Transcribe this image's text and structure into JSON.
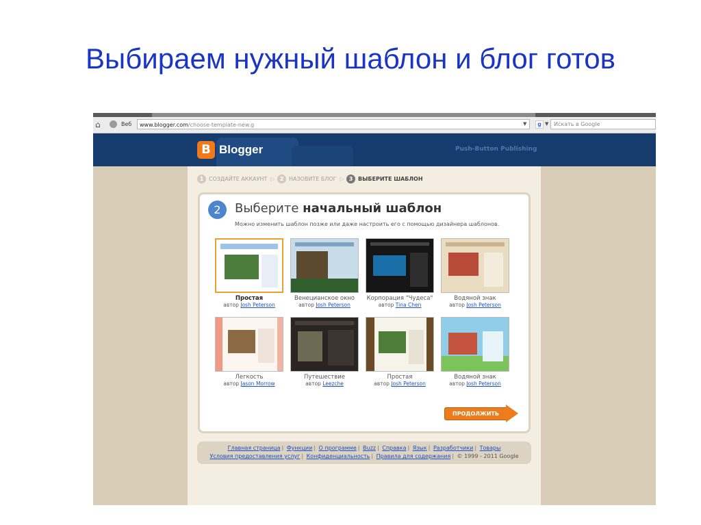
{
  "slide": {
    "title": "Выбираем нужный шаблон и блог готов"
  },
  "browser": {
    "home_icon": "home-icon",
    "web_label": "Веб",
    "url_domain": "www.blogger.com",
    "url_path": "/choose-template-new.g",
    "search_placeholder": "Искать в Google"
  },
  "blogger": {
    "logo_letter": "B",
    "name": "Blogger",
    "slogan": "Push-Button Publishing"
  },
  "steps": [
    {
      "num": "1",
      "label": "СОЗДАЙТЕ АККАУНТ"
    },
    {
      "num": "2",
      "label": "НАЗОВИТЕ БЛОГ"
    },
    {
      "num": "3",
      "label": "ВЫБЕРИТЕ ШАБЛОН"
    }
  ],
  "panel": {
    "step_number": "2",
    "title_plain": "Выберите ",
    "title_bold": "начальный шаблон",
    "subtitle": "Можно изменить шаблон позже или даже настроить его с помощью дизайнера шаблонов."
  },
  "templates": [
    {
      "name": "Простая",
      "by": "автор",
      "author": "Josh Peterson",
      "selected": true
    },
    {
      "name": "Венецианское окно",
      "by": "автор",
      "author": "Josh Peterson"
    },
    {
      "name": "Корпорация \"Чудеса\"",
      "by": "автор",
      "author": "Tina Chen"
    },
    {
      "name": "Водяной знак",
      "by": "автор",
      "author": "Josh Peterson"
    },
    {
      "name": "Легкость",
      "by": "автор",
      "author": "Jason Morrow"
    },
    {
      "name": "Путешествие",
      "by": "автор",
      "author": "Leezche"
    },
    {
      "name": "Простая",
      "by": "автор",
      "author": "Josh Peterson"
    },
    {
      "name": "Водяной знак",
      "by": "автор",
      "author": "Josh Peterson"
    }
  ],
  "continue_label": "ПРОДОЛЖИТЬ",
  "footer": {
    "row1": [
      "Главная страница",
      "Функции",
      "О программе",
      "Buzz",
      "Справка",
      "Язык",
      "Разработчики",
      "Товары"
    ],
    "row2": [
      "Условия предоставления услуг",
      "Конфиденциальность",
      "Правила для содержания"
    ],
    "copyright": "© 1999 - 2011 Google"
  },
  "colors": {
    "slide_title": "#1a35c4",
    "blogger_orange": "#f07a1b",
    "header_blue": "#163b6d",
    "step_blue": "#4d86cc",
    "link": "#1a4fc7"
  }
}
